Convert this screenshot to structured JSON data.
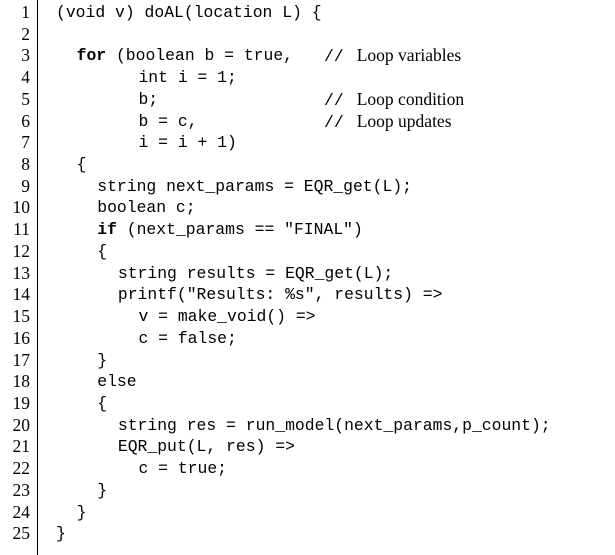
{
  "figure": {
    "kind": "numbered-source-code-listing",
    "language_style": "C-like pseudocode",
    "line_count": 25,
    "colors": {
      "background": "#ffffff",
      "text": "#000000",
      "gutter_rule": "#000000"
    }
  },
  "lines": [
    {
      "n": "1",
      "indent": 0,
      "code": "(void v) doAL(location L) {",
      "bold_prefix": "",
      "comment": null,
      "comment_col": null
    },
    {
      "n": "2",
      "indent": 0,
      "code": "",
      "bold_prefix": "",
      "comment": null,
      "comment_col": null
    },
    {
      "n": "3",
      "indent": 2,
      "code": " (boolean b = true,",
      "bold_prefix": "for",
      "comment": "Loop variables",
      "comment_col": 26
    },
    {
      "n": "4",
      "indent": 8,
      "code": "int i = 1;",
      "bold_prefix": "",
      "comment": null,
      "comment_col": null
    },
    {
      "n": "5",
      "indent": 8,
      "code": "b;",
      "bold_prefix": "",
      "comment": "Loop condition",
      "comment_col": 26
    },
    {
      "n": "6",
      "indent": 8,
      "code": "b = c,",
      "bold_prefix": "",
      "comment": "Loop updates",
      "comment_col": 26
    },
    {
      "n": "7",
      "indent": 8,
      "code": "i = i + 1)",
      "bold_prefix": "",
      "comment": null,
      "comment_col": null
    },
    {
      "n": "8",
      "indent": 2,
      "code": "{",
      "bold_prefix": "",
      "comment": null,
      "comment_col": null
    },
    {
      "n": "9",
      "indent": 4,
      "code": "string next_params = EQR_get(L);",
      "bold_prefix": "",
      "comment": null,
      "comment_col": null
    },
    {
      "n": "10",
      "indent": 4,
      "code": "boolean c;",
      "bold_prefix": "",
      "comment": null,
      "comment_col": null
    },
    {
      "n": "11",
      "indent": 4,
      "code": " (next_params == \"FINAL\")",
      "bold_prefix": "if",
      "comment": null,
      "comment_col": null
    },
    {
      "n": "12",
      "indent": 4,
      "code": "{",
      "bold_prefix": "",
      "comment": null,
      "comment_col": null
    },
    {
      "n": "13",
      "indent": 6,
      "code": "string results = EQR_get(L);",
      "bold_prefix": "",
      "comment": null,
      "comment_col": null
    },
    {
      "n": "14",
      "indent": 6,
      "code": "printf(\"Results: %s\", results) =>",
      "bold_prefix": "",
      "comment": null,
      "comment_col": null
    },
    {
      "n": "15",
      "indent": 8,
      "code": "v = make_void() =>",
      "bold_prefix": "",
      "comment": null,
      "comment_col": null
    },
    {
      "n": "16",
      "indent": 8,
      "code": "c = false;",
      "bold_prefix": "",
      "comment": null,
      "comment_col": null
    },
    {
      "n": "17",
      "indent": 4,
      "code": "}",
      "bold_prefix": "",
      "comment": null,
      "comment_col": null
    },
    {
      "n": "18",
      "indent": 4,
      "code": "else",
      "bold_prefix": "",
      "comment": null,
      "comment_col": null
    },
    {
      "n": "19",
      "indent": 4,
      "code": "{",
      "bold_prefix": "",
      "comment": null,
      "comment_col": null
    },
    {
      "n": "20",
      "indent": 6,
      "code": "string res = run_model(next_params,p_count);",
      "bold_prefix": "",
      "comment": null,
      "comment_col": null
    },
    {
      "n": "21",
      "indent": 6,
      "code": "EQR_put(L, res) =>",
      "bold_prefix": "",
      "comment": null,
      "comment_col": null
    },
    {
      "n": "22",
      "indent": 8,
      "code": "c = true;",
      "bold_prefix": "",
      "comment": null,
      "comment_col": null
    },
    {
      "n": "23",
      "indent": 4,
      "code": "}",
      "bold_prefix": "",
      "comment": null,
      "comment_col": null
    },
    {
      "n": "24",
      "indent": 2,
      "code": "}",
      "bold_prefix": "",
      "comment": null,
      "comment_col": null
    },
    {
      "n": "25",
      "indent": 0,
      "code": "}",
      "bold_prefix": "",
      "comment": null,
      "comment_col": null
    }
  ],
  "comment_marker": "//"
}
